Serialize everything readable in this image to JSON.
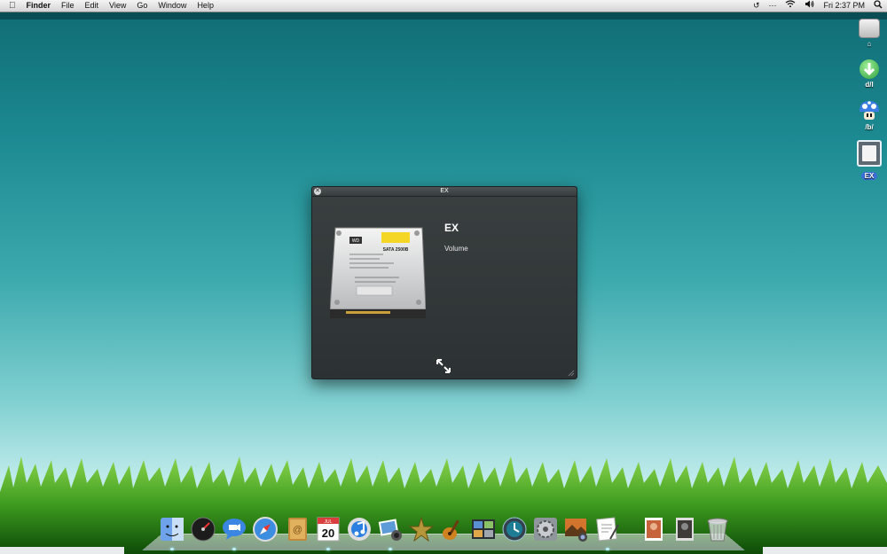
{
  "menubar": {
    "apple": "",
    "app_name": "Finder",
    "menus": [
      "File",
      "Edit",
      "View",
      "Go",
      "Window",
      "Help"
    ],
    "clock": "Fri 2:37 PM",
    "status_icons": [
      "time-machine-icon",
      "bluetooth-icon",
      "wifi-icon",
      "volume-icon",
      "spotlight-icon"
    ]
  },
  "desktop_icons": [
    {
      "label": "",
      "icon": "home-drive-icon"
    },
    {
      "label": "d/l",
      "icon": "download-arrow-icon"
    },
    {
      "label": "/b/",
      "icon": "mushroom-icon"
    },
    {
      "label": "EX",
      "icon": "document-drive-icon",
      "selected": true
    }
  ],
  "info_window": {
    "title": "EX",
    "name": "EX",
    "kind": "Volume",
    "drive_label": "WD",
    "drive_sticker": "SATA 2500B"
  },
  "dock": {
    "items": [
      "finder-icon",
      "dashboard-icon",
      "ichat-icon",
      "safari-icon",
      "address-book-icon",
      "ical-icon",
      "itunes-icon",
      "iphoto-icon",
      "imovie-icon",
      "garageband-icon",
      "spaces-icon",
      "time-machine-icon",
      "system-preferences-icon",
      "image-capture-icon",
      "preview-icon",
      "photo-stack-icon",
      "photo-stack-2-icon",
      "trash-icon"
    ],
    "calendar_month": "JUL",
    "calendar_day": "20"
  },
  "colors": {
    "sky_top": "#106a73",
    "sky_bottom": "#d8f3f0",
    "window_bg": "#2c3233",
    "selection": "#3a6fd8"
  }
}
